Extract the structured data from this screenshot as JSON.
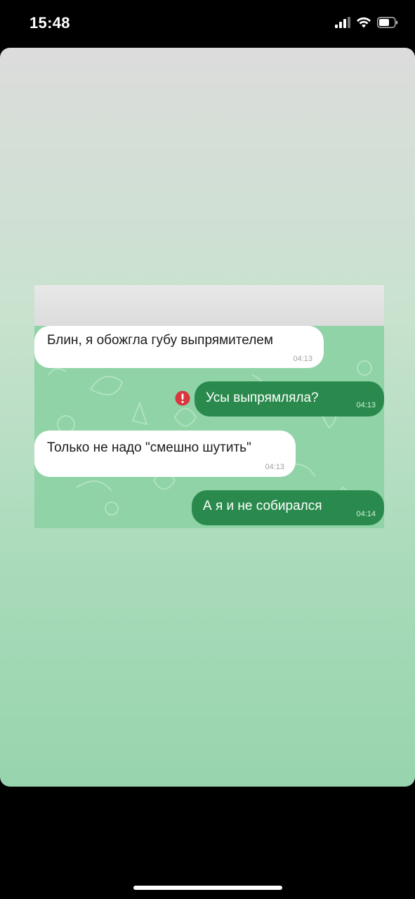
{
  "status_bar": {
    "time": "15:48",
    "icons": [
      "cellular-signal-icon",
      "wifi-icon",
      "battery-icon"
    ]
  },
  "chat": {
    "messages": [
      {
        "direction": "incoming",
        "text": "Блин, я обожгла губу выпрямителем",
        "time": "04:13"
      },
      {
        "direction": "outgoing",
        "text": "Усы выпрямляла?",
        "time": "04:13",
        "status": "error-icon"
      },
      {
        "direction": "incoming",
        "text": "Только не надо \"смешно шутить\"",
        "time": "04:13"
      },
      {
        "direction": "outgoing",
        "text": "А я и не собирался",
        "time": "04:14"
      }
    ]
  },
  "colors": {
    "incoming_bubble": "#ffffff",
    "outgoing_bubble": "#2a8a4d",
    "chat_background": "#8fd3a6",
    "error": "#d9363e"
  }
}
